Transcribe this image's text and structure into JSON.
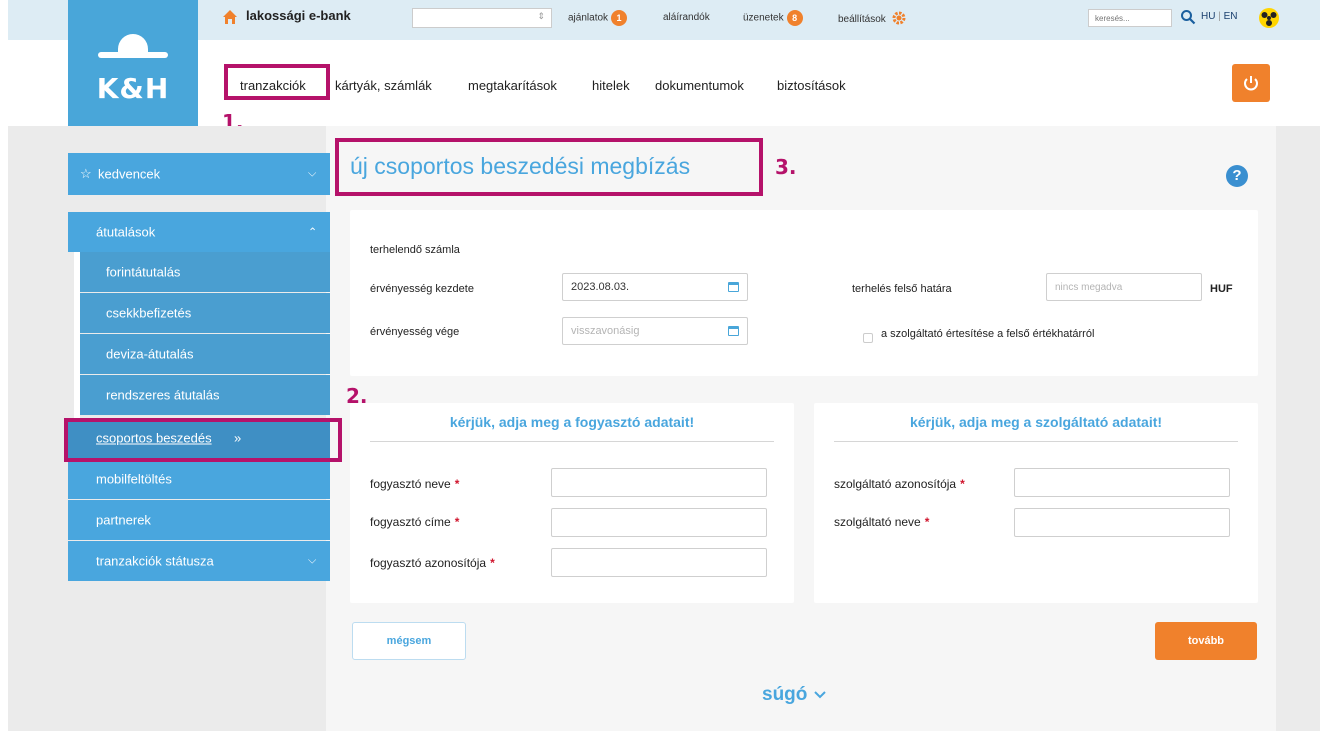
{
  "brand": {
    "logo_text": "K&H",
    "app_title": "lakossági e-bank"
  },
  "topbar": {
    "account_select_value": "",
    "offers_label": "ajánlatok",
    "offers_count": "1",
    "to_sign_label": "aláírandók",
    "messages_label": "üzenetek",
    "messages_count": "8",
    "settings_label": "beállítások",
    "search_placeholder": "keresés...",
    "lang_hu": "HU",
    "lang_en": "EN"
  },
  "menu": {
    "items": [
      "tranzakciók",
      "kártyák, számlák",
      "megtakarítások",
      "hitelek",
      "dokumentumok",
      "biztosítások"
    ]
  },
  "sidebar": {
    "favorites": "kedvencek",
    "transfers": "átutalások",
    "sub": [
      "forintátutalás",
      "csekkbefizetés",
      "deviza-átutalás",
      "rendszeres átutalás"
    ],
    "group_debit": "csoportos beszedés",
    "group_debit_arrow": "»",
    "mobile_topup": "mobilfeltöltés",
    "partners": "partnerek",
    "tx_status": "tranzakciók státusza"
  },
  "annotations": {
    "one": "1.",
    "two": "2.",
    "three": "3."
  },
  "page": {
    "title": "új csoportos beszedési megbízás",
    "help_icon": "?"
  },
  "form_top": {
    "debit_account_label": "terhelendő számla",
    "valid_from_label": "érvényesség kezdete",
    "valid_from_value": "2023.08.03.",
    "valid_to_label": "érvényesség vége",
    "valid_to_placeholder": "visszavonásig",
    "limit_label": "terhelés felső határa",
    "limit_placeholder": "nincs megadva",
    "currency": "HUF",
    "notify_label": "a szolgáltató értesítése a felső értékhatárról"
  },
  "consumer": {
    "title": "kérjük, adja meg a fogyasztó adatait!",
    "name_label": "fogyasztó neve",
    "address_label": "fogyasztó címe",
    "id_label": "fogyasztó azonosítója",
    "required_mark": "*"
  },
  "provider": {
    "title": "kérjük, adja meg a szolgáltató adatait!",
    "id_label": "szolgáltató azonosítója",
    "name_label": "szolgáltató neve",
    "required_mark": "*"
  },
  "buttons": {
    "cancel": "mégsem",
    "next": "tovább"
  },
  "help": {
    "label": "súgó"
  },
  "colors": {
    "brand_blue": "#49a6de",
    "accent_orange": "#f0812c",
    "highlight": "#b5126a"
  }
}
